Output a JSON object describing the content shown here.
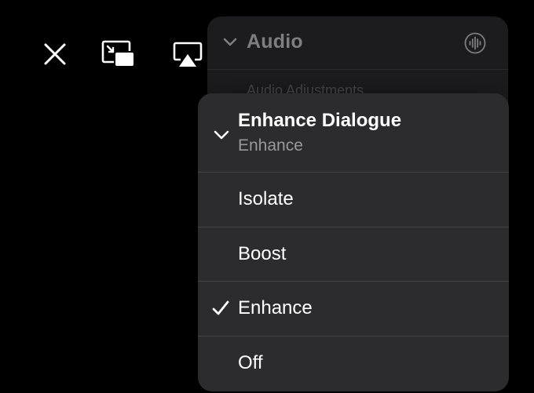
{
  "controls": {
    "close_icon": "close-icon",
    "pip_icon": "picture-in-picture-icon",
    "airplay_icon": "airplay-icon"
  },
  "audio_panel": {
    "title": "Audio",
    "subheading": "Audio Adjustments",
    "icon": "waveform-icon"
  },
  "menu": {
    "header": {
      "title": "Enhance Dialogue",
      "subtitle": "Enhance"
    },
    "items": [
      {
        "label": "Isolate",
        "selected": false
      },
      {
        "label": "Boost",
        "selected": false
      },
      {
        "label": "Enhance",
        "selected": true
      },
      {
        "label": "Off",
        "selected": false
      }
    ]
  },
  "colors": {
    "background": "#000000",
    "menu_bg": "#2c2c2e",
    "panel_bg": "#1c1c1e",
    "text_primary": "#ffffff",
    "text_secondary": "#98989d"
  }
}
